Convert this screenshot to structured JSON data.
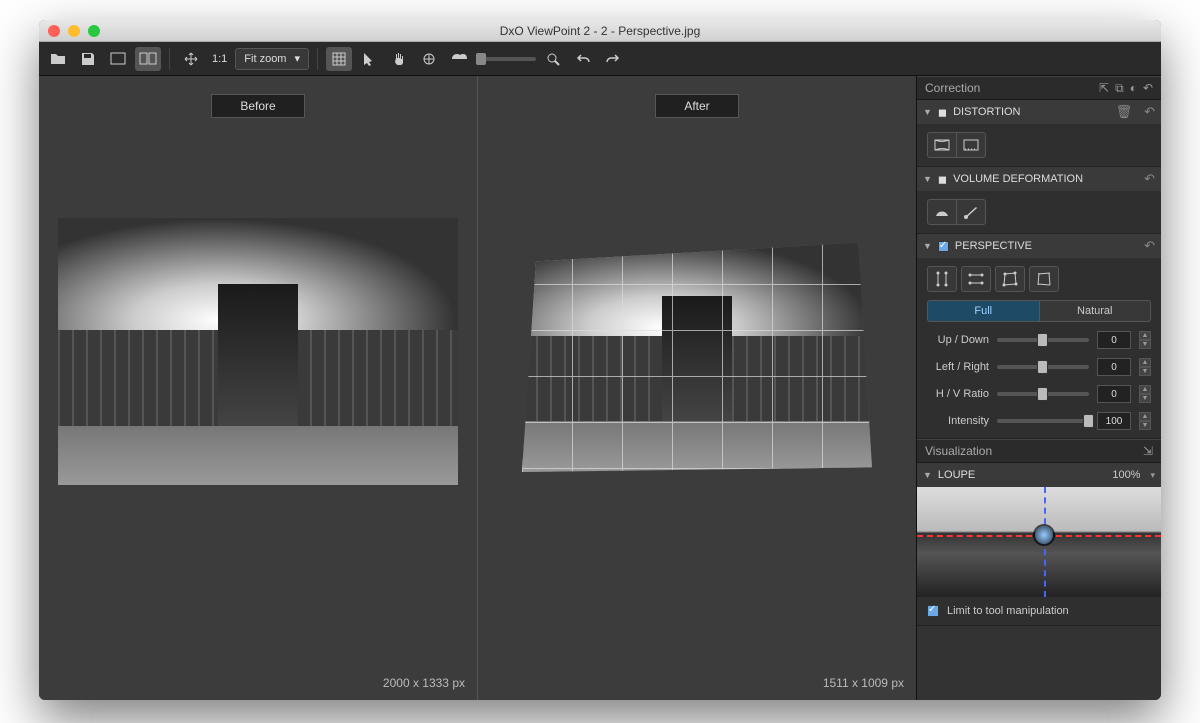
{
  "window": {
    "title": "DxO ViewPoint 2 - 2 - Perspective.jpg"
  },
  "toolbar": {
    "ratio_label": "1:1",
    "zoom_label": "Fit zoom"
  },
  "viewer": {
    "before_label": "Before",
    "after_label": "After",
    "before_dims": "2000 x 1333 px",
    "after_dims": "1511 x 1009 px"
  },
  "sidebar": {
    "correction_label": "Correction",
    "distortion": {
      "title": "DISTORTION"
    },
    "volume": {
      "title": "VOLUME DEFORMATION"
    },
    "perspective": {
      "title": "PERSPECTIVE",
      "mode_full": "Full",
      "mode_natural": "Natural",
      "sliders": [
        {
          "label": "Up / Down",
          "value": "0",
          "pos": 50
        },
        {
          "label": "Left / Right",
          "value": "0",
          "pos": 50
        },
        {
          "label": "H / V Ratio",
          "value": "0",
          "pos": 50
        },
        {
          "label": "Intensity",
          "value": "100",
          "pos": 100
        }
      ]
    },
    "visualization_label": "Visualization",
    "loupe": {
      "title": "LOUPE",
      "zoom": "100%",
      "limit_label": "Limit to tool manipulation"
    }
  }
}
